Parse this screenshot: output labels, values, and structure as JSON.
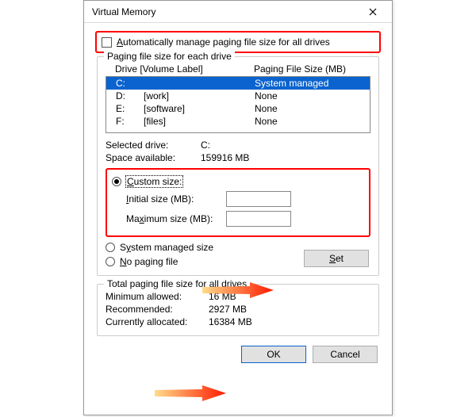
{
  "window": {
    "title": "Virtual Memory"
  },
  "auto": {
    "label_pre": "A",
    "label_rest": "utomatically manage paging file size for all drives",
    "checked": false
  },
  "group": {
    "legend": "Paging file size for each drive",
    "head_drive": "Drive  [Volume Label]",
    "head_size": "Paging File Size (MB)"
  },
  "drives": [
    {
      "letter": "C:",
      "label": "",
      "size": "System managed",
      "selected": true
    },
    {
      "letter": "D:",
      "label": "[work]",
      "size": "None",
      "selected": false
    },
    {
      "letter": "E:",
      "label": "[software]",
      "size": "None",
      "selected": false
    },
    {
      "letter": "F:",
      "label": "[files]",
      "size": "None",
      "selected": false
    }
  ],
  "selected": {
    "label": "Selected drive:",
    "value": "C:",
    "space_label": "Space available:",
    "space_value": "159916 MB"
  },
  "opts": {
    "custom_u": "C",
    "custom_rest": "ustom size:",
    "initial_u": "I",
    "initial_rest": "nitial size (MB):",
    "max_pre": "Ma",
    "max_u": "x",
    "max_rest": "imum size (MB):",
    "sys_pre": "S",
    "sys_u": "y",
    "sys_rest": "stem managed size",
    "none_u": "N",
    "none_rest": "o paging file",
    "set_u": "S",
    "set_rest": "et"
  },
  "totals": {
    "legend": "Total paging file size for all drives",
    "min_label": "Minimum allowed:",
    "min_value": "16 MB",
    "rec_label": "Recommended:",
    "rec_value": "2927 MB",
    "cur_label": "Currently allocated:",
    "cur_value": "16384 MB"
  },
  "buttons": {
    "ok": "OK",
    "cancel": "Cancel"
  }
}
